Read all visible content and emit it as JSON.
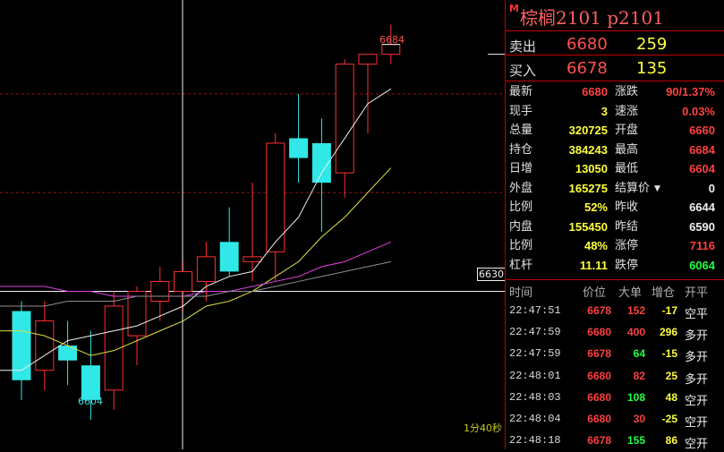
{
  "header": {
    "badge": "M",
    "title": "棕榈2101  p2101"
  },
  "order_book": {
    "ask": {
      "label": "卖出",
      "price": "6680",
      "volume": "259"
    },
    "bid": {
      "label": "买入",
      "price": "6678",
      "volume": "135"
    }
  },
  "stats": [
    {
      "l1": "最新",
      "v1": "6680",
      "c1": "red",
      "l2": "涨跌",
      "v2": "90/1.37%",
      "c2": "red"
    },
    {
      "l1": "现手",
      "v1": "3",
      "c1": "yellow",
      "l2": "速涨",
      "v2": "0.03%",
      "c2": "red"
    },
    {
      "l1": "总量",
      "v1": "320725",
      "c1": "yellow",
      "l2": "开盘",
      "v2": "6660",
      "c2": "red"
    },
    {
      "l1": "持仓",
      "v1": "384243",
      "c1": "yellow",
      "l2": "最高",
      "v2": "6684",
      "c2": "red"
    },
    {
      "l1": "日增",
      "v1": "13050",
      "c1": "yellow",
      "l2": "最低",
      "v2": "6604",
      "c2": "red"
    },
    {
      "l1": "外盘",
      "v1": "165275",
      "c1": "yellow",
      "l2": "结算价",
      "v2": "0",
      "c2": "white"
    },
    {
      "l1": "比例",
      "v1": "52%",
      "c1": "yellow",
      "l2": "昨收",
      "v2": "6644",
      "c2": "white"
    },
    {
      "l1": "内盘",
      "v1": "155450",
      "c1": "yellow",
      "l2": "昨结",
      "v2": "6590",
      "c2": "white"
    },
    {
      "l1": "比例",
      "v1": "48%",
      "c1": "yellow",
      "l2": "涨停",
      "v2": "7116",
      "c2": "red"
    },
    {
      "l1": "杠杆",
      "v1": "11.11",
      "c1": "yellow",
      "l2": "跌停",
      "v2": "6064",
      "c2": "green"
    }
  ],
  "trades": {
    "headers": [
      "时间",
      "价位",
      "大单",
      "增仓",
      "开平"
    ],
    "rows": [
      {
        "time": "22:47:51",
        "price": "6678",
        "vol": "152",
        "vc": "red",
        "delta": "-17",
        "dc": "yellow",
        "kind": "空平"
      },
      {
        "time": "22:47:59",
        "price": "6680",
        "vol": "400",
        "vc": "red",
        "delta": "296",
        "dc": "yellow",
        "kind": "多开"
      },
      {
        "time": "22:47:59",
        "price": "6678",
        "vol": "64",
        "vc": "green",
        "delta": "-15",
        "dc": "yellow",
        "kind": "多开"
      },
      {
        "time": "22:48:01",
        "price": "6680",
        "vol": "82",
        "vc": "red",
        "delta": "25",
        "dc": "yellow",
        "kind": "多开"
      },
      {
        "time": "22:48:03",
        "price": "6680",
        "vol": "108",
        "vc": "green",
        "delta": "48",
        "dc": "yellow",
        "kind": "空开"
      },
      {
        "time": "22:48:04",
        "price": "6680",
        "vol": "30",
        "vc": "red",
        "delta": "-25",
        "dc": "yellow",
        "kind": "空开"
      },
      {
        "time": "22:48:18",
        "price": "6678",
        "vol": "155",
        "vc": "green",
        "delta": "86",
        "dc": "yellow",
        "kind": "空开"
      }
    ]
  },
  "chart_data": {
    "type": "candlestick",
    "ylim": [
      6598,
      6689
    ],
    "crosshair_price": 6630,
    "crosshair_label": "6630",
    "high_label": "6684",
    "low_label": "6604",
    "timer": "1分40秒",
    "candles": [
      {
        "o": 6626,
        "h": 6628,
        "l": 6608,
        "c": 6612
      },
      {
        "o": 6614,
        "h": 6628,
        "l": 6610,
        "c": 6624
      },
      {
        "o": 6619,
        "h": 6624,
        "l": 6611,
        "c": 6616
      },
      {
        "o": 6615,
        "h": 6622,
        "l": 6604,
        "c": 6608
      },
      {
        "o": 6610,
        "h": 6630,
        "l": 6606,
        "c": 6627
      },
      {
        "o": 6621,
        "h": 6631,
        "l": 6615,
        "c": 6630
      },
      {
        "o": 6628,
        "h": 6635,
        "l": 6624,
        "c": 6632
      },
      {
        "o": 6630,
        "h": 6636,
        "l": 6626,
        "c": 6634
      },
      {
        "o": 6632,
        "h": 6640,
        "l": 6628,
        "c": 6637
      },
      {
        "o": 6640,
        "h": 6647,
        "l": 6633,
        "c": 6634
      },
      {
        "o": 6636,
        "h": 6652,
        "l": 6632,
        "c": 6637
      },
      {
        "o": 6638,
        "h": 6662,
        "l": 6632,
        "c": 6660
      },
      {
        "o": 6661,
        "h": 6670,
        "l": 6652,
        "c": 6657
      },
      {
        "o": 6660,
        "h": 6665,
        "l": 6642,
        "c": 6652
      },
      {
        "o": 6654,
        "h": 6677,
        "l": 6649,
        "c": 6676
      },
      {
        "o": 6676,
        "h": 6678,
        "l": 6662,
        "c": 6678
      },
      {
        "o": 6678,
        "h": 6684,
        "l": 6676,
        "c": 6680
      }
    ],
    "ma_series": [
      {
        "color": "#f0f0f0",
        "values": [
          6614,
          6617,
          6620,
          6621,
          6622,
          6623,
          6625,
          6627,
          6631,
          6633,
          6634,
          6640,
          6645,
          6654,
          6661,
          6668,
          6671
        ]
      },
      {
        "color": "#e0e040",
        "values": [
          6622,
          6621,
          6619,
          6617,
          6618,
          6620,
          6622,
          6624,
          6627,
          6628,
          6630,
          6633,
          6636,
          6641,
          6645,
          6650,
          6655
        ]
      },
      {
        "color": "#e040e0",
        "values": [
          6631,
          6631,
          6630,
          6630,
          6629,
          6629,
          6629,
          6629,
          6630,
          6630,
          6631,
          6632,
          6633,
          6635,
          6636,
          6638,
          6640
        ]
      },
      {
        "color": "#909090",
        "values": [
          6627,
          6627,
          6628,
          6628,
          6628,
          6629,
          6629,
          6629,
          6629,
          6630,
          6630,
          6631,
          6632,
          6633,
          6634,
          6635,
          6636
        ]
      }
    ]
  }
}
